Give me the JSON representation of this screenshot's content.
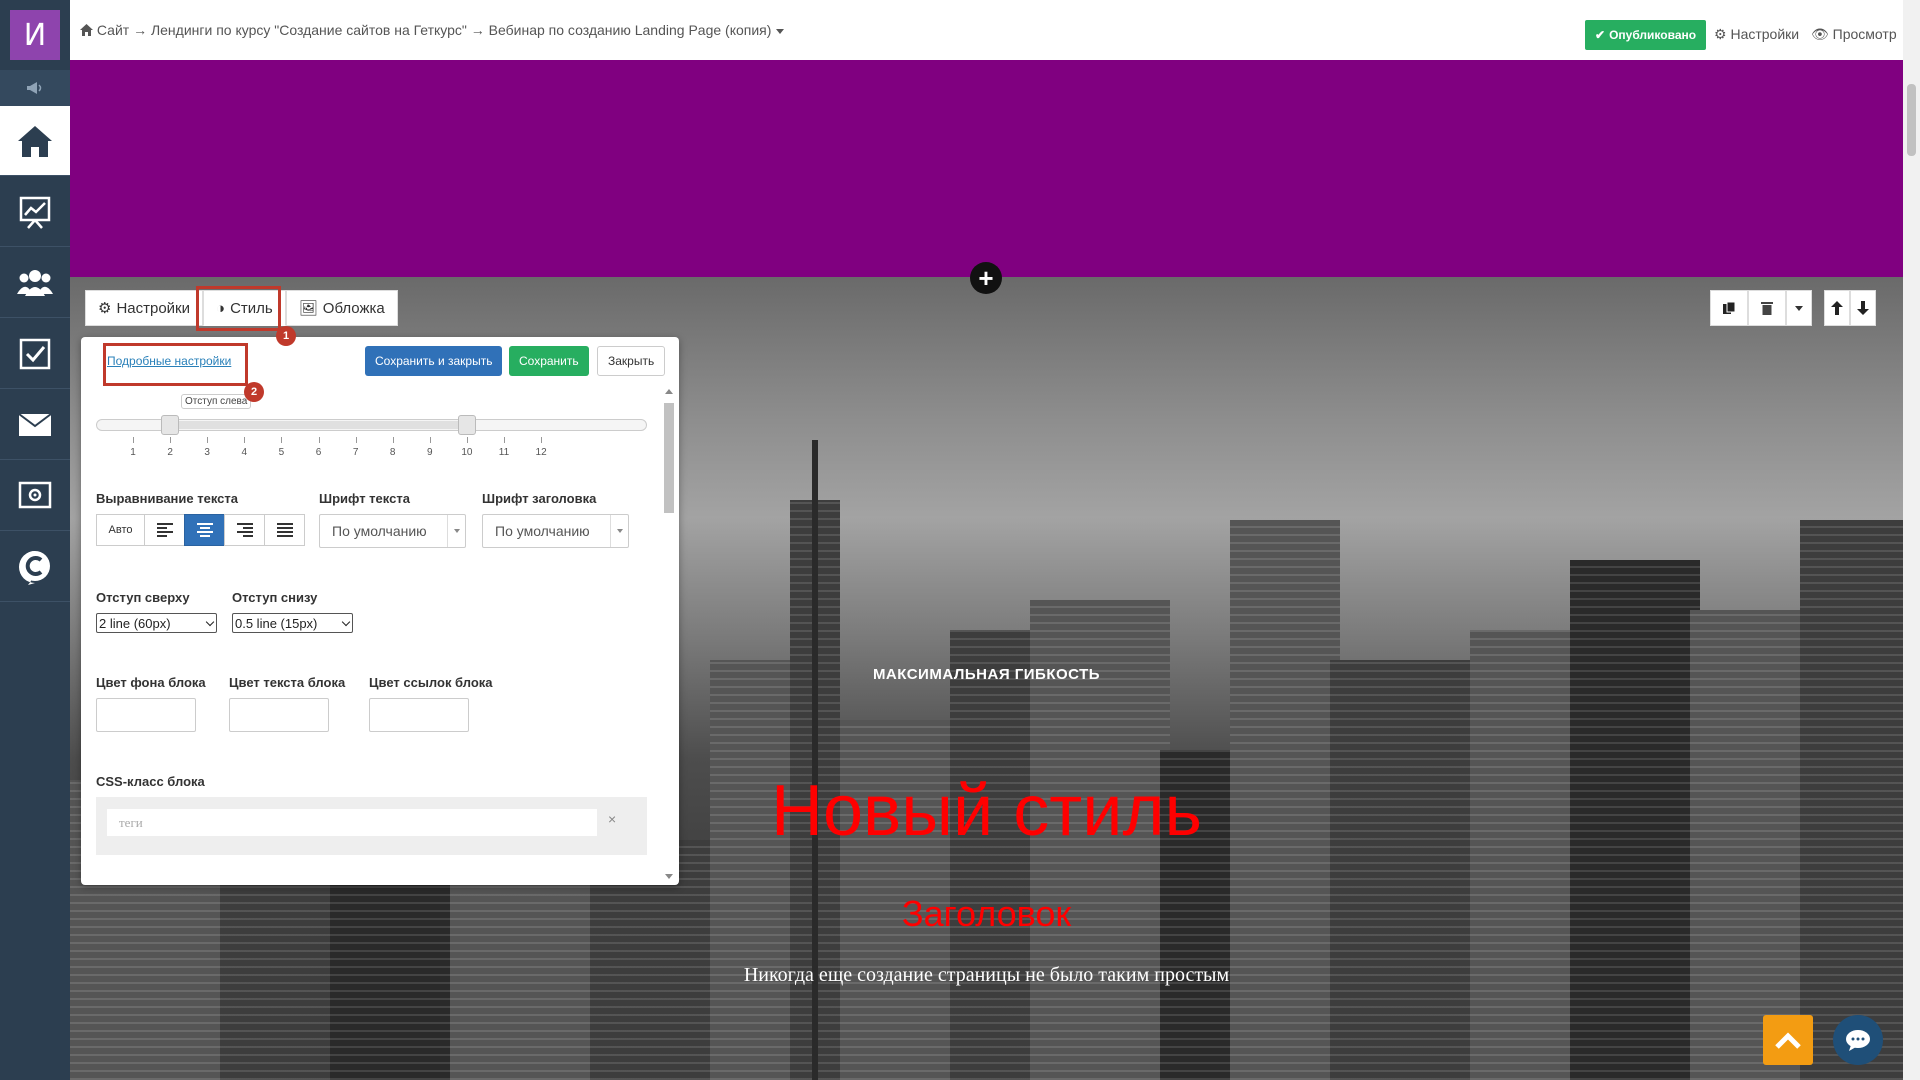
{
  "app": {
    "logo_letter": "И"
  },
  "sidebar": {
    "items": [
      {
        "icon": "home-icon",
        "active": true
      },
      {
        "icon": "chart-icon",
        "active": false
      },
      {
        "icon": "users-icon",
        "active": false
      },
      {
        "icon": "tasks-icon",
        "active": false
      },
      {
        "icon": "mail-icon",
        "active": false
      },
      {
        "icon": "settings-icon",
        "active": false
      },
      {
        "icon": "chat-c-icon",
        "active": false
      }
    ]
  },
  "topbar": {
    "breadcrumb": "Сайт → Лендинги по курсу \"Создание сайтов на Геткурс\" → Вебинар по созданию Landing Page (копия)",
    "published_label": "Опубликовано",
    "settings_label": "Настройки",
    "preview_label": "Просмотр"
  },
  "block_tabs": {
    "settings_label": "Настройки",
    "style_label": "Стиль",
    "cover_label": "Обложка"
  },
  "annotations": {
    "badge1": "1",
    "badge2": "2"
  },
  "panel": {
    "advanced_link": "Подробные настройки",
    "save_close_label": "Сохранить и закрыть",
    "save_label": "Сохранить",
    "close_label": "Закрыть",
    "slider_tooltip": "Отступ слева",
    "slider_ticks": [
      "1",
      "2",
      "3",
      "4",
      "5",
      "6",
      "7",
      "8",
      "9",
      "10",
      "11",
      "12"
    ],
    "slider_value_from": 2,
    "slider_value_to": 10,
    "text_align_label": "Выравнивание текста",
    "align_auto": "Авто",
    "text_font_label": "Шрифт текста",
    "text_font_value": "По умолчанию",
    "heading_font_label": "Шрифт заголовка",
    "heading_font_value": "По умолчанию",
    "padding_top_label": "Отступ сверху",
    "padding_top_value": "2 line (60px)",
    "padding_bottom_label": "Отступ снизу",
    "padding_bottom_value": "0.5 line (15px)",
    "bg_color_label": "Цвет фона блока",
    "text_color_label": "Цвет текста блока",
    "link_color_label": "Цвет ссылок блока",
    "css_class_label": "CSS-класс блока",
    "tags_placeholder": "теги",
    "tags_clear": "×"
  },
  "hero": {
    "kicker": "МАКСИМАЛЬНАЯ ГИБКОСТЬ",
    "title": "Новый стиль",
    "subtitle": "Заголовок",
    "text": "Никогда еще создание страницы не было таким простым"
  },
  "colors": {
    "purple_block": "#800080",
    "published_green": "#27ae60",
    "primary_blue": "#3071b8",
    "hero_red": "#ff0000",
    "annotation_red": "#c0392b",
    "sidebar_bg": "#2c3e50"
  }
}
